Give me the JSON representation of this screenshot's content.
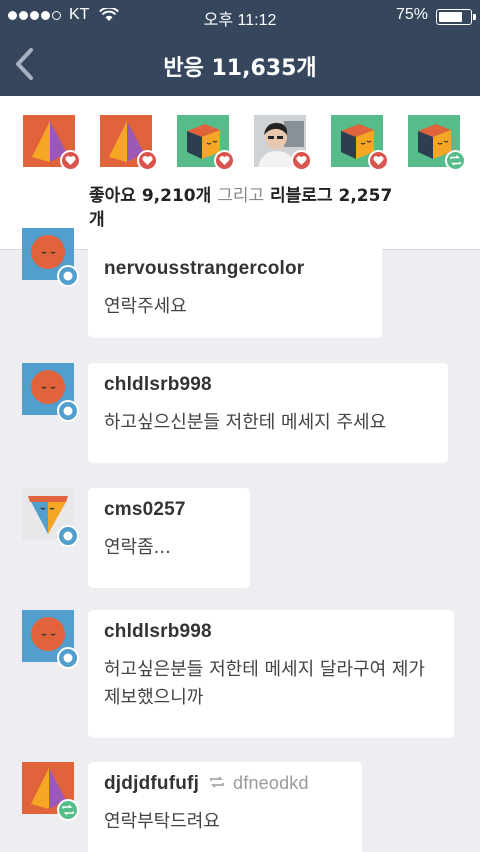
{
  "status_bar": {
    "carrier": "KT",
    "time": "오후 11:12",
    "battery": "75%"
  },
  "header": {
    "title": "반응 11,635개"
  },
  "reactions": {
    "avatars": [
      {
        "kind": "pyramid",
        "action": "like"
      },
      {
        "kind": "pyramid",
        "action": "like"
      },
      {
        "kind": "cube",
        "action": "like"
      },
      {
        "kind": "photo",
        "action": "like"
      },
      {
        "kind": "cube",
        "action": "like"
      },
      {
        "kind": "cube",
        "action": "reblog"
      }
    ],
    "likes_label": "좋아요 9,210개",
    "conjunction": "그리고",
    "reblogs_label": "리블로그 2,257",
    "reblogs_suffix": "개"
  },
  "notes": [
    {
      "username": "nervousstrangercolor",
      "message": "연락주세요",
      "avatar": "orange-face",
      "type": "comment"
    },
    {
      "username": "chldlsrb998",
      "message": "하고싶으신분들 저한테 메세지 주세요",
      "avatar": "orange-face",
      "type": "comment"
    },
    {
      "username": "cms0257",
      "message": "연락좀...",
      "avatar": "cone",
      "type": "comment"
    },
    {
      "username": "chldlsrb998",
      "message": "허고싶은분들 저한테 메세지 달라구여 제가 제보했으니까",
      "avatar": "orange-face",
      "type": "comment"
    },
    {
      "username": "djdjdfufufj",
      "reblogged_from": "dfneodkd",
      "message": "연락부탁드려요",
      "avatar": "pyramid",
      "type": "reblog"
    }
  ],
  "colors": {
    "header_bg": "#36465d",
    "like": "#d9534f",
    "reblog": "#56bc8a",
    "comment": "#529ecc"
  }
}
